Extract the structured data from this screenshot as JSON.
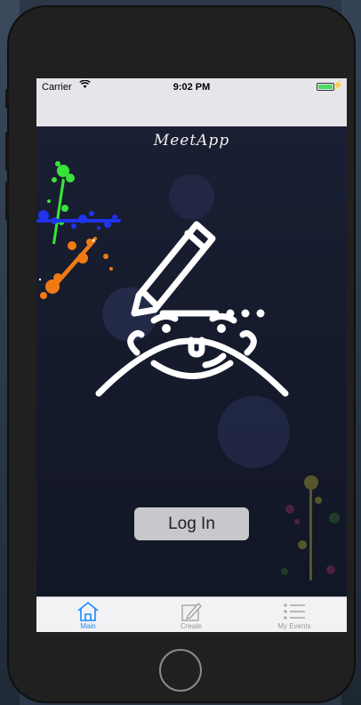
{
  "status_bar": {
    "carrier": "Carrier",
    "time": "9:02 PM",
    "wifi_icon": "wifi-icon",
    "battery_level": 1.0,
    "battery_color": "#4cd964"
  },
  "app": {
    "logo_text": "MeetApp"
  },
  "main": {
    "login_label": "Log In"
  },
  "tabbar": {
    "items": [
      {
        "label": "Main",
        "icon": "home-icon",
        "active": true
      },
      {
        "label": "Create",
        "icon": "pencil-square-icon",
        "active": false
      },
      {
        "label": "My Events",
        "icon": "list-icon",
        "active": false
      }
    ]
  },
  "colors": {
    "accent": "#1a8cff",
    "splash_green": "#39e339",
    "splash_orange": "#f07a12",
    "splash_blue": "#2233ee"
  }
}
